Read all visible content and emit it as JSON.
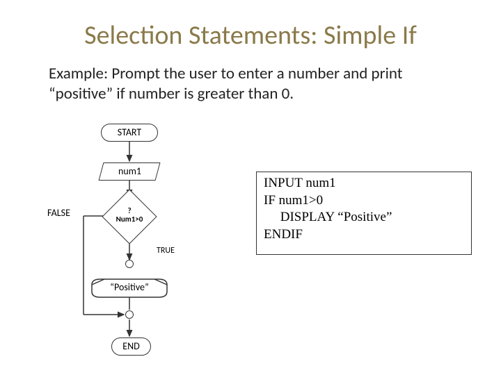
{
  "title": "Selection Statements: Simple If",
  "subtitle": "Example: Prompt the user to enter a number and print “positive” if number is greater than 0.",
  "flowchart": {
    "start": "START",
    "input": "num1",
    "decision_line1": "?",
    "decision_line2": "Num1>0",
    "false_label": "FALSE",
    "true_label": "TRUE",
    "output": "“Positive”",
    "end": "END"
  },
  "pseudocode": "INPUT num1\nIF num1>0\n     DISPLAY “Positive”\nENDIF"
}
